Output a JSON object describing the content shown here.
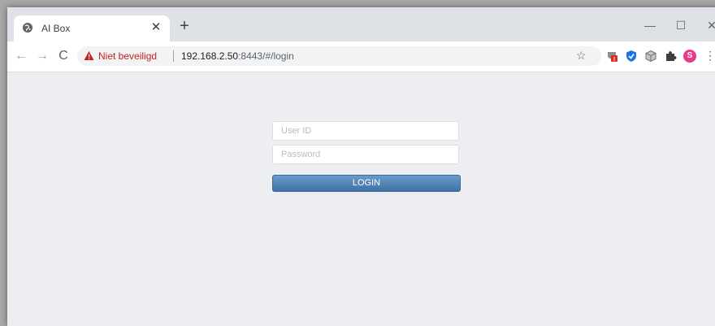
{
  "tab": {
    "title": "AI Box"
  },
  "address_bar": {
    "security_label": "Niet beveiligd",
    "url_host": "192.168.2.50",
    "url_rest": ":8443/#/login"
  },
  "profile": {
    "initial": "S",
    "color": "#e8398c"
  },
  "extensions": [
    "ublock-icon",
    "shield-icon",
    "cube-icon",
    "puzzle-icon"
  ],
  "extension_badge": "!",
  "login_form": {
    "user_id_placeholder": "User ID",
    "password_placeholder": "Password",
    "login_label": "LOGIN"
  },
  "colors": {
    "page_background": "#eceef1",
    "login_button": "#4a7db0",
    "security_warning": "#c5221f"
  }
}
